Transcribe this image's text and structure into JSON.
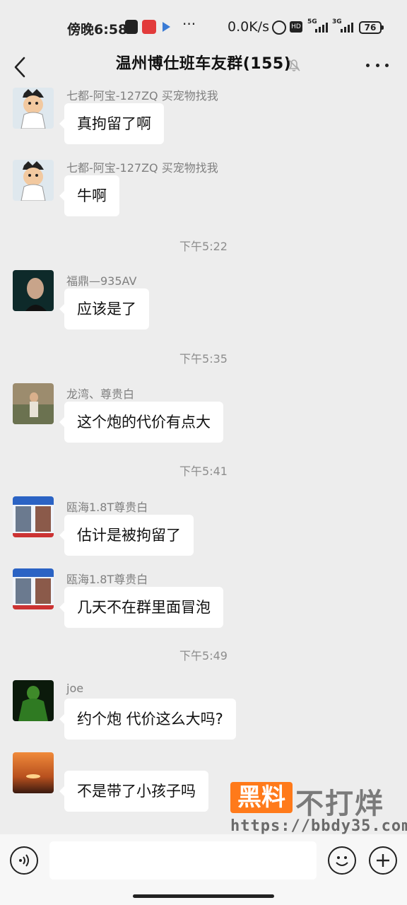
{
  "status_bar": {
    "time": "傍晚6:58",
    "network_speed": "0.0K/s",
    "signal_1_label": "5G",
    "signal_2_label": "3G",
    "battery": "76",
    "hd_label": "HD",
    "icons": [
      "sim-icon",
      "app-notification-icon",
      "play-icon",
      "more-dots-icon",
      "alarm-icon",
      "hd-icon",
      "signal-icon",
      "battery-icon"
    ]
  },
  "header": {
    "title": "温州博仕班车友群(155)",
    "icons": [
      "back-icon",
      "mute-bell-icon",
      "more-icon"
    ]
  },
  "messages": [
    {
      "type": "message",
      "sender": "七都-阿宝-127ZQ 买宠物找我",
      "text": "真拘留了啊",
      "avatar": "cartoon-avatar"
    },
    {
      "type": "message",
      "sender": "七都-阿宝-127ZQ 买宠物找我",
      "text": "牛啊",
      "avatar": "cartoon-avatar"
    },
    {
      "type": "time",
      "text": "下午5:22"
    },
    {
      "type": "message",
      "sender": "福鼎—935AV",
      "text": "应该是了",
      "avatar": "portrait-avatar"
    },
    {
      "type": "time",
      "text": "下午5:35"
    },
    {
      "type": "message",
      "sender": "龙湾、尊贵白",
      "text": "这个炮的代价有点大",
      "avatar": "outdoor-photo-avatar"
    },
    {
      "type": "time",
      "text": "下午5:41"
    },
    {
      "type": "message",
      "sender": "瓯海1.8T尊贵白",
      "text": "估计是被拘留了",
      "avatar": "poster-avatar"
    },
    {
      "type": "message",
      "sender": "瓯海1.8T尊贵白",
      "text": "几天不在群里面冒泡",
      "avatar": "poster-avatar"
    },
    {
      "type": "time",
      "text": "下午5:49"
    },
    {
      "type": "message",
      "sender": "joe",
      "text": "约个炮 代价这么大吗?",
      "avatar": "green-figure-avatar"
    },
    {
      "type": "message",
      "sender": "",
      "text": "不是带了小孩子吗",
      "avatar": "sunset-avatar"
    }
  ],
  "watermark": {
    "badge": "黑料",
    "text": "不打烊",
    "url": "https://bbdy35.com"
  },
  "input_bar": {
    "placeholder": "",
    "icons": [
      "voice-icon",
      "emoji-icon",
      "plus-icon"
    ]
  },
  "colors": {
    "background": "#ededed",
    "bubble": "#ffffff",
    "sender_text": "#808080",
    "timestamp_text": "#8d8d8d",
    "watermark_orange": "#ff7a1a"
  }
}
